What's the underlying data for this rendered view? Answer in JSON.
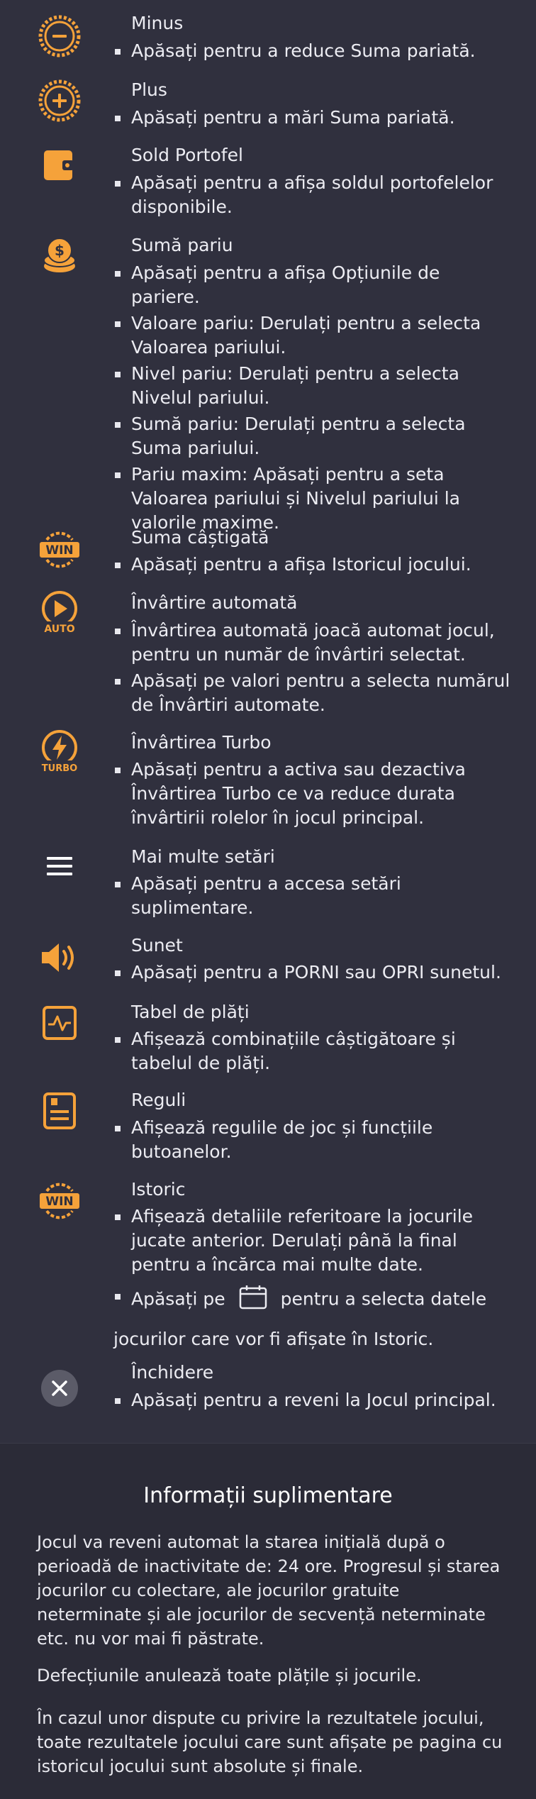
{
  "accent": "#f5a23a",
  "items": [
    {
      "icon": "minus-circle-icon",
      "title": "Minus",
      "bullets": [
        "Apăsați pentru a reduce Suma pariată."
      ]
    },
    {
      "icon": "plus-circle-icon",
      "title": "Plus",
      "bullets": [
        "Apăsați pentru a mări Suma pariată."
      ]
    },
    {
      "icon": "wallet-icon",
      "title": "Sold Portofel",
      "bullets": [
        "Apăsați pentru a afișa soldul portofelelor disponibile."
      ]
    },
    {
      "icon": "coins-icon",
      "title": "Sumă pariu",
      "bullets": [
        "Apăsați pentru a afișa Opțiunile de pariere.",
        "Valoare pariu: Derulați pentru a selecta Valoarea pariului.",
        "Nivel pariu: Derulați pentru a selecta Nivelul pariului.",
        "Sumă pariu: Derulați pentru a selecta Suma pariului.",
        "Pariu maxim: Apăsați pentru a seta Valoarea pariului și Nivelul pariului la valorile maxime."
      ]
    },
    {
      "icon": "win-badge-icon",
      "icon_text": "WIN",
      "title": "Suma câștigată",
      "bullets": [
        "Apăsați pentru a afișa Istoricul jocului."
      ]
    },
    {
      "icon": "autoplay-icon",
      "icon_text": "AUTO",
      "title": "Învârtire automată",
      "bullets": [
        "Învârtirea automată joacă automat jocul, pentru un număr de învârtiri selectat.",
        "Apăsați pe valori pentru a selecta numărul de Învârtiri automate."
      ]
    },
    {
      "icon": "turbo-icon",
      "icon_text": "TURBO",
      "title": "Învârtirea Turbo",
      "bullets": [
        "Apăsați pentru a activa sau dezactiva Învârtirea Turbo ce va reduce durata învârtirii rolelor în jocul principal."
      ]
    },
    {
      "icon": "menu-icon",
      "title": "Mai multe setări",
      "bullets": [
        "Apăsați pentru a accesa setări suplimentare."
      ]
    },
    {
      "icon": "sound-icon",
      "title": "Sunet",
      "bullets": [
        "Apăsați pentru a PORNI sau OPRI sunetul."
      ]
    },
    {
      "icon": "paytable-icon",
      "title": "Tabel de plăți",
      "bullets": [
        "Afișează combinațiile câștigătoare și tabelul de plăți."
      ]
    },
    {
      "icon": "rules-icon",
      "title": "Reguli",
      "bullets": [
        "Afișează regulile de joc și funcțiile butoanelor."
      ]
    },
    {
      "icon": "history-win-icon",
      "icon_text": "WIN",
      "title": "Istoric",
      "bullets": [
        "Afișează detaliile referitoare la jocurile jucate anterior. Derulați până la final pentru a încărca mai multe date."
      ]
    },
    {
      "icon": "close-icon",
      "title": "Închidere",
      "bullets": [
        "Apăsați pentru a reveni la Jocul principal."
      ]
    }
  ],
  "history_calendar": {
    "before": "Apăsați pe",
    "after": "pentru a selecta datele",
    "line2": "jocurilor care vor fi afișate în Istoric.",
    "icon": "calendar-icon"
  },
  "footer": {
    "heading": "Informații suplimentare",
    "paragraphs": [
      "Jocul va reveni automat la starea inițială după o perioadă de inactivitate de: 24 ore. Progresul și starea jocurilor cu colectare, ale jocurilor gratuite neterminate și ale jocurilor de secvență neterminate etc. nu vor mai fi păstrate.",
      "Defecțiunile anulează toate plățile și jocurile.",
      "În cazul unor dispute cu privire la rezultatele jocului, toate rezultatele jocului care sunt afișate pe pagina cu istoricul jocului sunt absolute și finale."
    ]
  }
}
